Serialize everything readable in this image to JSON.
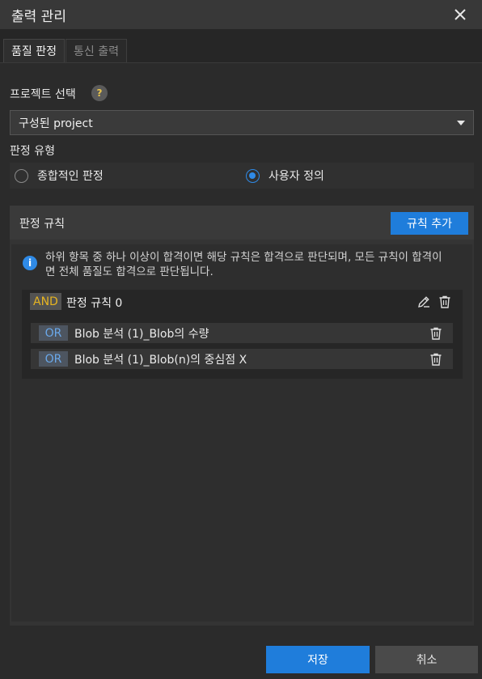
{
  "window": {
    "title": "출력 관리",
    "close_icon": "close-icon"
  },
  "tabs": [
    {
      "label": "품질 판정",
      "active": true
    },
    {
      "label": "통신 출력",
      "active": false
    }
  ],
  "project": {
    "label": "프로젝트 선택",
    "help": "?",
    "selected": "구성된 project"
  },
  "judgment_type": {
    "label": "판정 유형",
    "options": [
      {
        "label": "종합적인 판정",
        "checked": false
      },
      {
        "label": "사용자 정의",
        "checked": true
      }
    ]
  },
  "rules": {
    "label": "판정 규칙",
    "add_button": "규칙 추가",
    "info_icon": "i",
    "info_text": "하위 항목 중 하나 이상이 합격이면 해당 규칙은 합격으로 판단되며, 모든 규칙이 합격이면 전체 품질도 합격으로 판단됩니다.",
    "groups": [
      {
        "operator": "AND",
        "name": "판정 규칙 0",
        "conditions": [
          {
            "operator": "OR",
            "text": "Blob 분석 (1)_Blob의 수량"
          },
          {
            "operator": "OR",
            "text": "Blob 분석 (1)_Blob(n)의 중심점 X"
          }
        ]
      }
    ]
  },
  "footer": {
    "save": "저장",
    "cancel": "취소"
  },
  "colors": {
    "accent": "#1f7ddb",
    "and_tag": "#e6b422",
    "or_tag": "#6aa8ea"
  }
}
